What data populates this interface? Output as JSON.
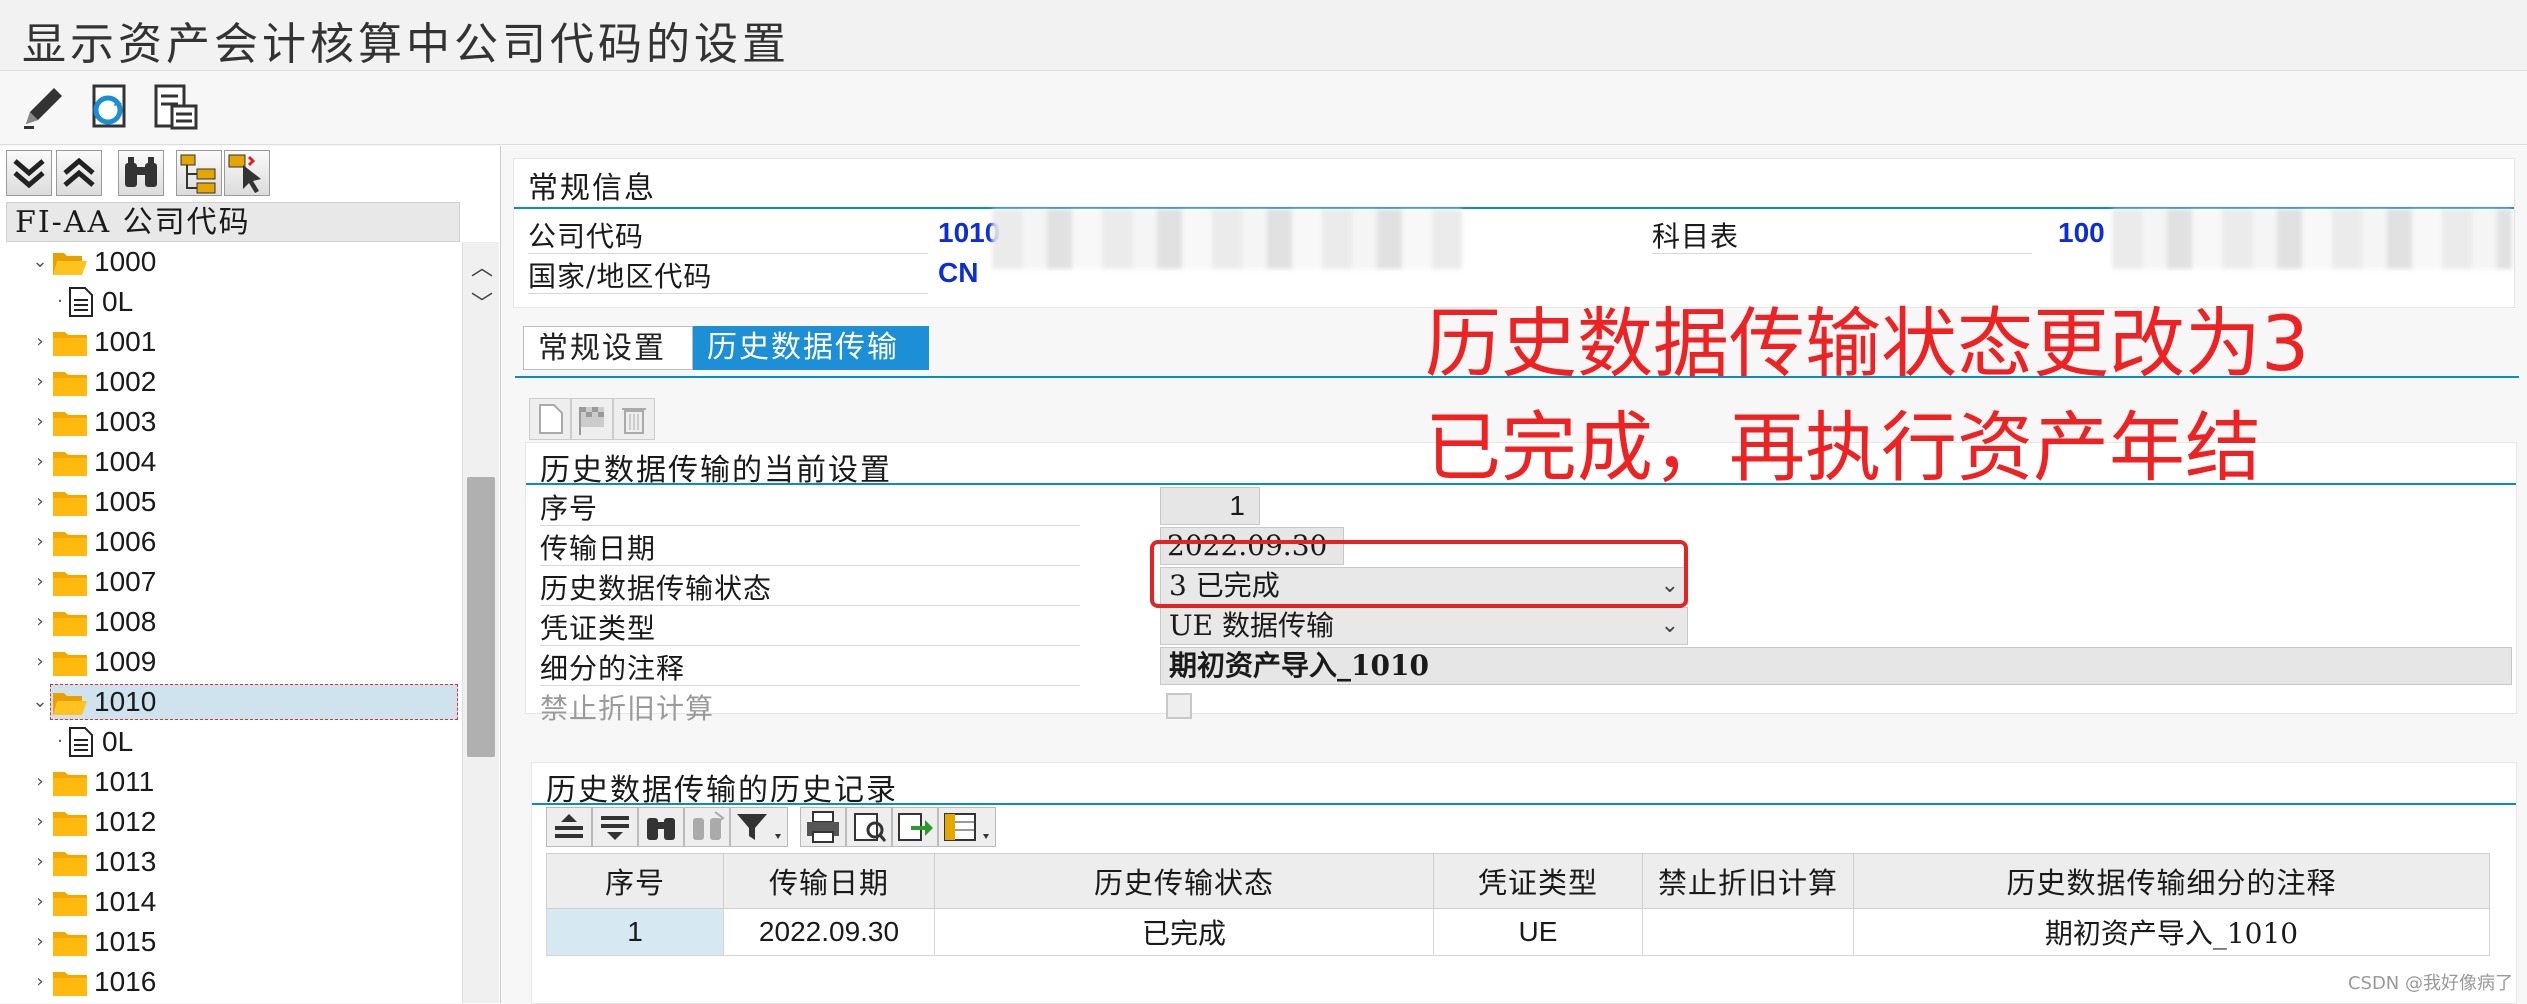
{
  "window": {
    "title": "显示资产会计核算中公司代码的设置"
  },
  "toolbar": {
    "icons": [
      "pencil-icon",
      "refresh-icon",
      "document-list-icon"
    ]
  },
  "tree": {
    "header": "FI-AA 公司代码",
    "nodes": [
      {
        "label": "1000",
        "expanded": true,
        "type": "folder-open"
      },
      {
        "label": "0L",
        "type": "document",
        "child": true
      },
      {
        "label": "1001",
        "type": "folder"
      },
      {
        "label": "1002",
        "type": "folder"
      },
      {
        "label": "1003",
        "type": "folder"
      },
      {
        "label": "1004",
        "type": "folder"
      },
      {
        "label": "1005",
        "type": "folder"
      },
      {
        "label": "1006",
        "type": "folder"
      },
      {
        "label": "1007",
        "type": "folder"
      },
      {
        "label": "1008",
        "type": "folder"
      },
      {
        "label": "1009",
        "type": "folder"
      },
      {
        "label": "1010",
        "expanded": true,
        "type": "folder-open",
        "selected": true
      },
      {
        "label": "0L",
        "type": "document",
        "child": true
      },
      {
        "label": "1011",
        "type": "folder"
      },
      {
        "label": "1012",
        "type": "folder"
      },
      {
        "label": "1013",
        "type": "folder"
      },
      {
        "label": "1014",
        "type": "folder"
      },
      {
        "label": "1015",
        "type": "folder"
      },
      {
        "label": "1016",
        "type": "folder"
      }
    ]
  },
  "general": {
    "title": "常规信息",
    "company_code_label": "公司代码",
    "company_code_value": "1010",
    "country_label": "国家/地区代码",
    "country_value": "CN",
    "chart_label": "科目表",
    "chart_value": "100"
  },
  "tabs": [
    {
      "label": "常规设置",
      "active": false
    },
    {
      "label": "历史数据传输",
      "active": true
    }
  ],
  "current": {
    "title": "历史数据传输的当前设置",
    "rows": [
      {
        "label": "序号",
        "value": "1"
      },
      {
        "label": "传输日期",
        "value": "2022.09.30"
      },
      {
        "label": "历史数据传输状态",
        "value": "3 已完成"
      },
      {
        "label": "凭证类型",
        "value": "UE 数据传输"
      },
      {
        "label": "细分的注释",
        "value": "期初资产导入_1010"
      },
      {
        "label": "禁止折旧计算",
        "value": ""
      }
    ]
  },
  "history": {
    "title": "历史数据传输的历史记录",
    "columns": [
      "序号",
      "传输日期",
      "历史传输状态",
      "凭证类型",
      "禁止折旧计算",
      "历史数据传输细分的注释"
    ],
    "rows": [
      [
        "1",
        "2022.09.30",
        "已完成",
        "UE",
        "",
        "期初资产导入_1010"
      ]
    ]
  },
  "annotation": {
    "line1": "历史数据传输状态更改为3",
    "line2": "已完成，再执行资产年结",
    "color": "#ee2222"
  },
  "watermark": "CSDN @我好像病了"
}
